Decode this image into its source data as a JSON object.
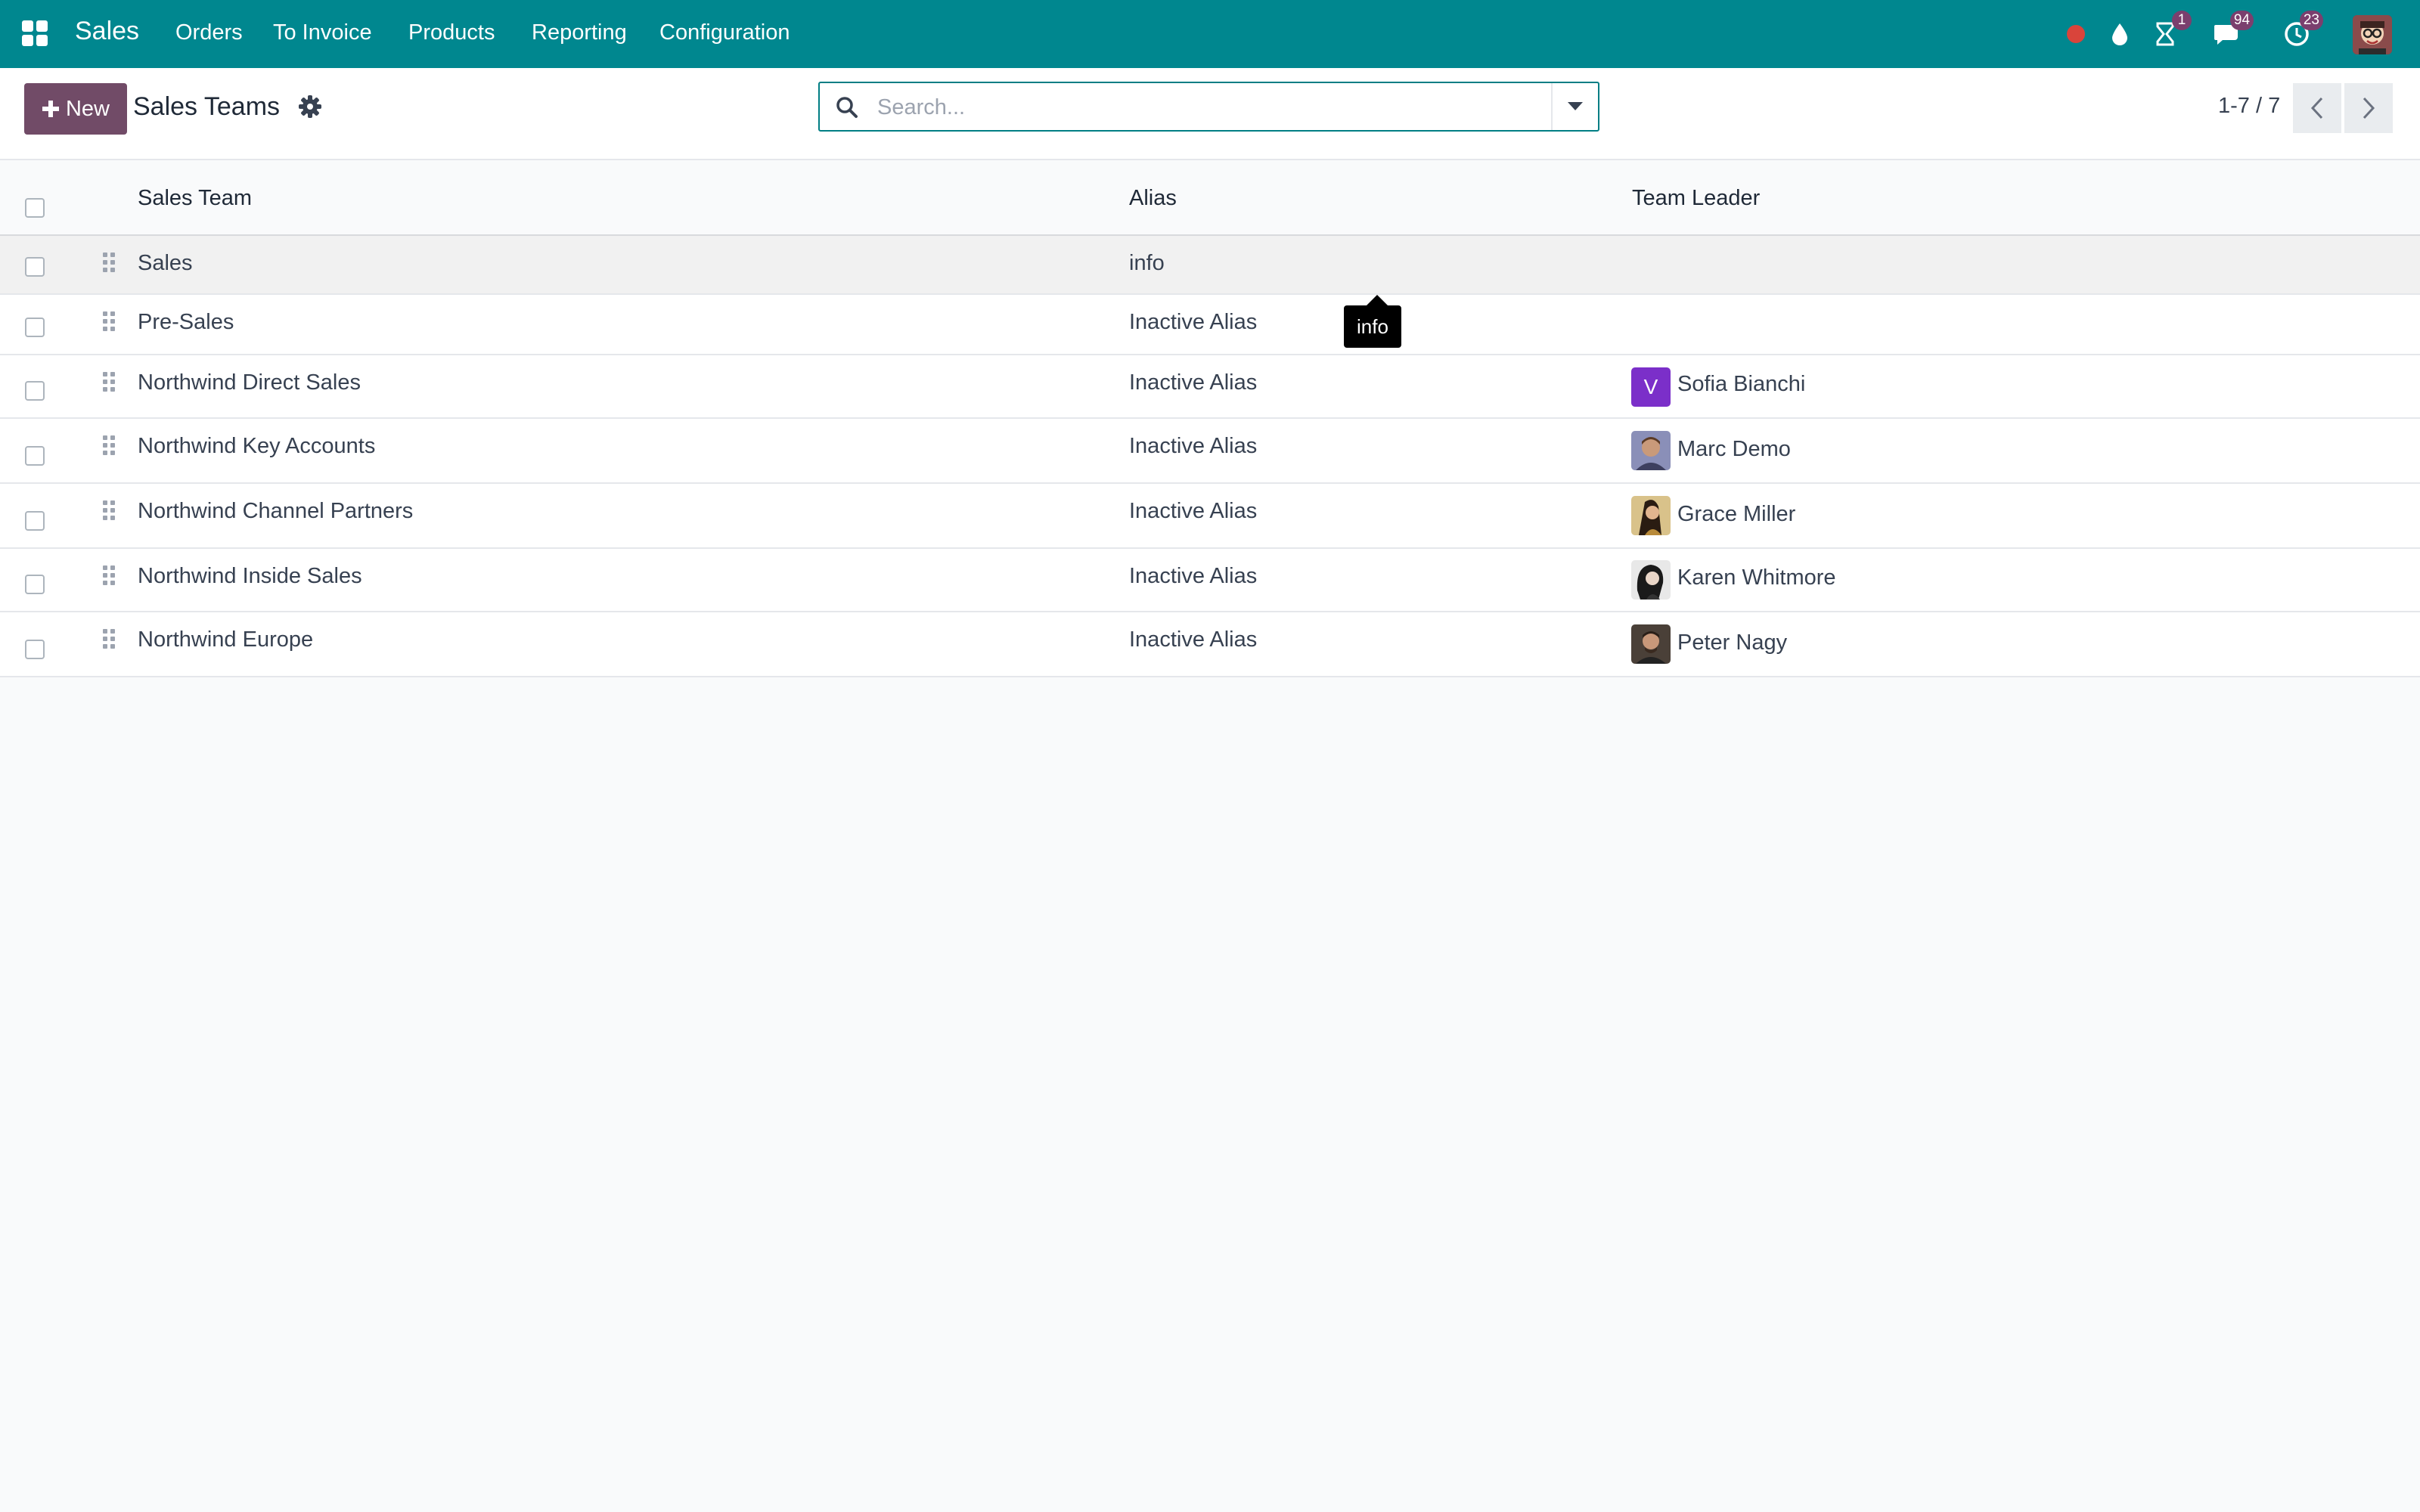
{
  "navbar": {
    "app_name": "Sales",
    "menu": [
      "Orders",
      "To Invoice",
      "Products",
      "Reporting",
      "Configuration"
    ],
    "activity_badge": "1",
    "messages_badge": "94",
    "updates_badge": "23",
    "accent_color": "#00878f"
  },
  "control": {
    "new_label": "New",
    "title": "Sales Teams",
    "search_placeholder": "Search...",
    "pager": "1-7 / 7"
  },
  "list": {
    "columns": [
      "Sales Team",
      "Alias",
      "Team Leader"
    ],
    "rows": [
      {
        "team": "Sales",
        "alias": "info",
        "leader": ""
      },
      {
        "team": "Pre-Sales",
        "alias": "Inactive Alias",
        "leader": ""
      },
      {
        "team": "Northwind Direct Sales",
        "alias": "Inactive Alias",
        "leader": "Sofia Bianchi",
        "leader_initial": "V"
      },
      {
        "team": "Northwind Key Accounts",
        "alias": "Inactive Alias",
        "leader": "Marc Demo"
      },
      {
        "team": "Northwind Channel Partners",
        "alias": "Inactive Alias",
        "leader": "Grace Miller"
      },
      {
        "team": "Northwind Inside Sales",
        "alias": "Inactive Alias",
        "leader": "Karen Whitmore"
      },
      {
        "team": "Northwind Europe",
        "alias": "Inactive Alias",
        "leader": "Peter Nagy"
      }
    ]
  },
  "tooltip": {
    "text": "info"
  }
}
